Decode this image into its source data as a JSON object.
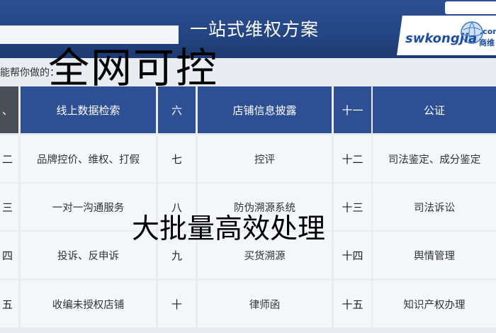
{
  "banner": {
    "title": "一站式维权方案"
  },
  "logo": {
    "text": "swkongjia",
    "com": ".com",
    "cn": "商维"
  },
  "subtitle": "能帮你做的：",
  "overlay": {
    "top": "全网可控",
    "middle": "大批量高效处理"
  },
  "table": {
    "header": [
      "、",
      "线上数据检索",
      "六",
      "店铺信息披露",
      "十一",
      "公证"
    ],
    "rows": [
      [
        "二",
        "品牌控价、维权、打假",
        "七",
        "控评",
        "十二",
        "司法鉴定、成分鉴定"
      ],
      [
        "三",
        "一对一沟通服务",
        "八",
        "防伪溯源系统",
        "十三",
        "司法诉讼"
      ],
      [
        "四",
        "投诉、反申诉",
        "九",
        "买货溯源",
        "十四",
        "舆情管理"
      ],
      [
        "五",
        "收编未授权店铺",
        "十",
        "律师函",
        "十五",
        "知识产权办理"
      ]
    ]
  },
  "colors": {
    "header_blue": "#2e4f93",
    "header_dark": "#4a4f57",
    "body_bg": "#f4f6f9"
  }
}
